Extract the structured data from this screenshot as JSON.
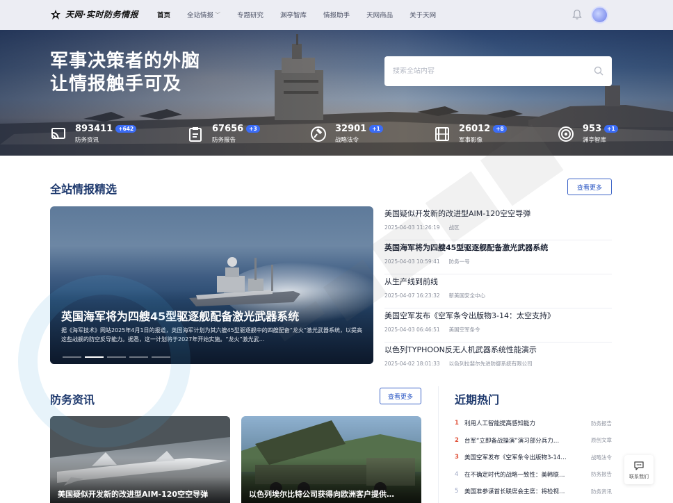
{
  "header": {
    "logo_text": "天网·实时防务情报",
    "nav": [
      "首页",
      "全站情报",
      "专题研究",
      "渊亭智库",
      "情报助手",
      "天网商品",
      "关于天网"
    ],
    "nav_dropdown_caret": "﹀"
  },
  "hero": {
    "title_line1": "军事决策者的外脑",
    "title_line2": "让情报触手可及",
    "search_placeholder": "搜索全站内容",
    "stats": [
      {
        "icon": "cast-icon",
        "number": "893411",
        "badge": "+642",
        "label": "防务资讯"
      },
      {
        "icon": "clipboard-icon",
        "number": "67656",
        "badge": "+3",
        "label": "防务报告"
      },
      {
        "icon": "gavel-icon",
        "number": "32901",
        "badge": "+1",
        "label": "战略法令"
      },
      {
        "icon": "film-icon",
        "number": "26012",
        "badge": "+8",
        "label": "军事影像"
      },
      {
        "icon": "target-icon",
        "number": "953",
        "badge": "+1",
        "label": "渊亭智库"
      }
    ]
  },
  "featured": {
    "section_title": "全站情报精选",
    "more_label": "查看更多",
    "slide_title": "英国海军将为四艘45型驱逐舰配备激光武器系统",
    "slide_desc": "据《海军技术》网站2025年4月1日的报道，英国海军计划为其六艘45型驱逐舰中的四艘配备“龙火”激光武器系统，以提高这些战舰的防空反导能力。据悉，这一计划将于2027年开始实施。“龙火”激光武…",
    "slide_count": 5,
    "active_slide": 2,
    "news": [
      {
        "title": "美国疑似开发新的改进型AIM-120空空导弹",
        "date": "2025-04-03 11:26:19",
        "source": "战区",
        "bold": false
      },
      {
        "title": "英国海军将为四艘45型驱逐舰配备激光武器系统",
        "date": "2025-04-03 10:59:41",
        "source": "防务一号",
        "bold": true
      },
      {
        "title": "从生产线到前线",
        "date": "2025-04-07 16:23:32",
        "source": "新美国安全中心",
        "bold": false
      },
      {
        "title": "美国空军发布《空军条令出版物3-14：太空支持》",
        "date": "2025-04-03 06:46:51",
        "source": "美国空军条令",
        "bold": false
      },
      {
        "title": "以色列TYPHOON反无人机武器系统性能演示",
        "date": "2025-04-02 18:01:33",
        "source": "以色列拉斐尔先进防御系统有限公司",
        "bold": false
      }
    ]
  },
  "defense": {
    "section_title": "防务资讯",
    "more_label": "查看更多",
    "cards": [
      {
        "title": "美国疑似开发新的改进型AIM-120空空导弹"
      },
      {
        "title": "以色列埃尔比特公司获得向欧洲客户提供…"
      }
    ]
  },
  "hot": {
    "section_title": "近期热门",
    "items": [
      {
        "rank": "1",
        "title": "利用人工智能提高感知能力",
        "tag": "防务报告"
      },
      {
        "rank": "2",
        "title": "台军“立即备战操演”演习部分兵力…",
        "tag": "原创文章"
      },
      {
        "rank": "3",
        "title": "美国空军发布《空军条令出版物3-14…",
        "tag": "战略法令"
      },
      {
        "rank": "4",
        "title": "在不确定时代的战略一致性：美韩联…",
        "tag": "防务报告"
      },
      {
        "rank": "5",
        "title": "美国准参谋首长联席会主席：将检视…",
        "tag": "防务资讯"
      }
    ]
  },
  "contact": {
    "label": "联系我们"
  },
  "colors": {
    "accent": "#2c58c4",
    "title": "#1f3a6e",
    "hot_rank": "#e0523a",
    "badge": "#3b6cf6"
  }
}
